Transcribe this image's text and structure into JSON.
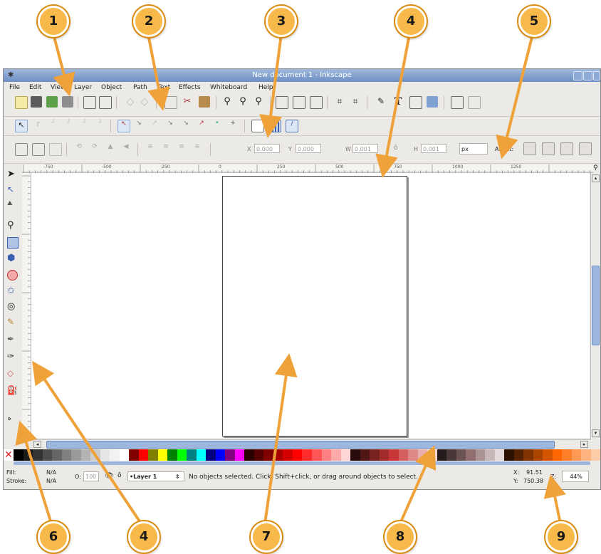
{
  "window": {
    "title": "New document 1 - Inkscape"
  },
  "menu": [
    "File",
    "Edit",
    "View",
    "Layer",
    "Object",
    "Path",
    "Text",
    "Effects",
    "Whiteboard",
    "Help"
  ],
  "controls_bar": {
    "x_label": "X",
    "x_value": "0.000",
    "y_label": "Y",
    "y_value": "0.000",
    "w_label": "W",
    "w_value": "0.001",
    "h_label": "H",
    "h_value": "0.001",
    "unit": "px",
    "affect_label": "Affect:"
  },
  "ruler": {
    "ticks": [
      "-750",
      "-500",
      "-250",
      "0",
      "250",
      "500",
      "750",
      "1000",
      "1250"
    ]
  },
  "status": {
    "fill_label": "Fill:",
    "fill_value": "N/A",
    "stroke_label": "Stroke:",
    "stroke_value": "N/A",
    "opacity_label": "O:",
    "opacity_value": "100",
    "layer": "•Layer 1",
    "message": "No objects selected. Click, Shift+click, or drag around objects to select.",
    "x_label": "X:",
    "x_value": "91.51",
    "y_label": "Y:",
    "y_value": "750.38",
    "zoom_label": "Z:",
    "zoom_value": "44%"
  },
  "palette_colors": [
    "#000000",
    "#1a1a1a",
    "#333333",
    "#4d4d4d",
    "#666666",
    "#808080",
    "#999999",
    "#b3b3b3",
    "#cccccc",
    "#e6e6e6",
    "#f2f2f2",
    "#ffffff",
    "#800000",
    "#ff0000",
    "#808000",
    "#ffff00",
    "#008000",
    "#00ff00",
    "#008080",
    "#00ffff",
    "#000080",
    "#0000ff",
    "#800080",
    "#ff00ff",
    "#2b0000",
    "#550000",
    "#800000",
    "#aa0000",
    "#d40000",
    "#ff0000",
    "#ff2a2a",
    "#ff5555",
    "#ff8080",
    "#ffaaaa",
    "#ffd5d5",
    "#280b0b",
    "#501616",
    "#782121",
    "#a02c2c",
    "#c83737",
    "#d35f5f",
    "#de8787",
    "#e9afaf",
    "#f4d7d7",
    "#241c1c",
    "#483737",
    "#6c5353",
    "#916f6f",
    "#ac9393",
    "#c8b7b7",
    "#e3dbdb",
    "#2b1100",
    "#552200",
    "#803300",
    "#aa4400",
    "#d45500",
    "#ff6600",
    "#ff7f2a",
    "#ff9955",
    "#ffb380",
    "#ffccaa"
  ],
  "callouts": [
    "1",
    "2",
    "3",
    "4",
    "5",
    "6",
    "4",
    "7",
    "8",
    "9"
  ]
}
